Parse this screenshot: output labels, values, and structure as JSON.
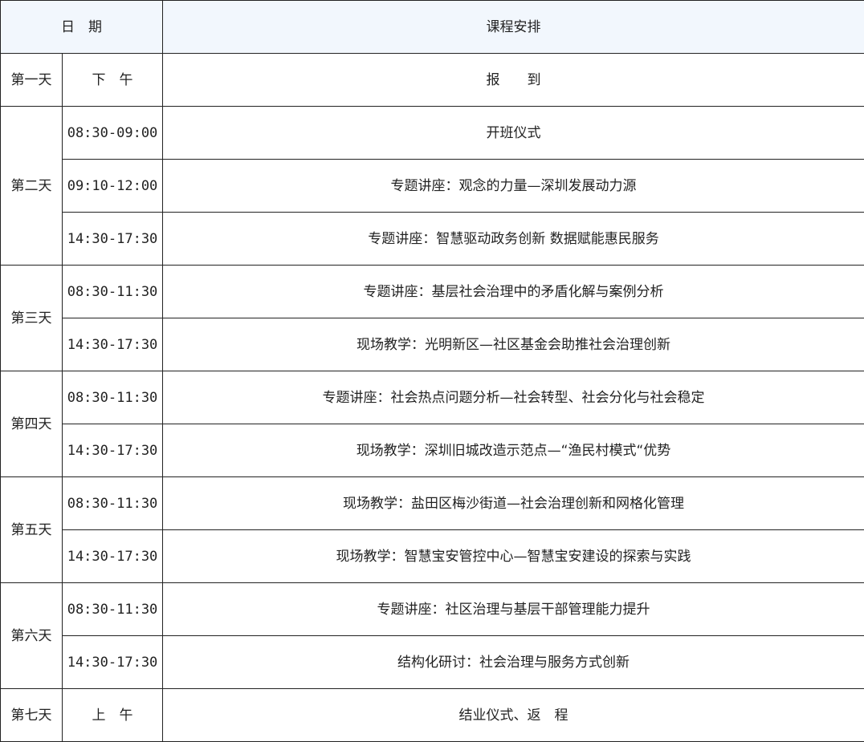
{
  "header": {
    "date": "日　期",
    "course": "课程安排"
  },
  "rows": [
    {
      "day": "第一天",
      "time": "下　午",
      "course": "报　　到"
    },
    {
      "day": "第二天",
      "time": "08:30-09:00",
      "course": "开班仪式"
    },
    {
      "time": "09:10-12:00",
      "course": "专题讲座：观念的力量—深圳发展动力源"
    },
    {
      "time": "14:30-17:30",
      "course": "专题讲座：智慧驱动政务创新 数据赋能惠民服务"
    },
    {
      "day": "第三天",
      "time": "08:30-11:30",
      "course": "专题讲座：基层社会治理中的矛盾化解与案例分析"
    },
    {
      "time": "14:30-17:30",
      "course": "现场教学：光明新区—社区基金会助推社会治理创新"
    },
    {
      "day": "第四天",
      "time": "08:30-11:30",
      "course": "专题讲座：社会热点问题分析—社会转型、社会分化与社会稳定"
    },
    {
      "time": "14:30-17:30",
      "course": "现场教学：深圳旧城改造示范点—“渔民村模式“优势"
    },
    {
      "day": "第五天",
      "time": "08:30-11:30",
      "course": "现场教学：盐田区梅沙街道—社会治理创新和网格化管理"
    },
    {
      "time": "14:30-17:30",
      "course": "现场教学：智慧宝安管控中心—智慧宝安建设的探索与实践"
    },
    {
      "day": "第六天",
      "time": "08:30-11:30",
      "course": "专题讲座：社区治理与基层干部管理能力提升"
    },
    {
      "time": "14:30-17:30",
      "course": "结构化研讨：社会治理与服务方式创新"
    },
    {
      "day": "第七天",
      "time": "上　午",
      "course": "结业仪式、返　程"
    }
  ]
}
